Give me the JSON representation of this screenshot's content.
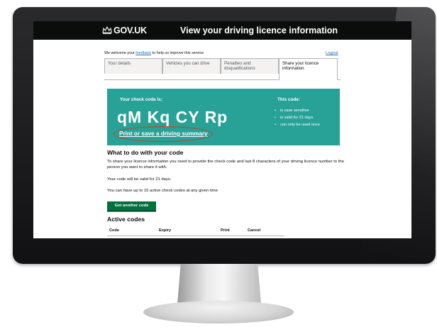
{
  "header": {
    "logo_text": "GOV.UK",
    "service_title": "View your driving licence information"
  },
  "feedback_bar": {
    "text_before": "We welcome your ",
    "link_text": "feedback",
    "text_after": " to help us improve this service",
    "logout_label": "Logout"
  },
  "tabs": [
    {
      "label": "Your details",
      "active": false
    },
    {
      "label": "Vehicles you can drive",
      "active": false
    },
    {
      "label": "Penalties and disqualifications",
      "active": false
    },
    {
      "label": "Share your licence information",
      "active": true
    }
  ],
  "code_panel": {
    "label": "Your check code is:",
    "code": "qM Kq CY Rp",
    "print_link": "Print or save a driving summary",
    "facts_title": "This code:",
    "facts": [
      "is case sensitive",
      "is valid for 21 days",
      "can only be used once"
    ],
    "panel_color": "#28a197",
    "highlight_color": "#d4351c"
  },
  "instructions": {
    "heading": "What to do with your code",
    "paragraph1": "To share your licence information you need to provide the check code and last 8 characters of your driving licence number to the person you want to share it with.",
    "paragraph2": "Your code will be valid for 21 days.",
    "paragraph3": "You can have up to 15 active check codes at any given time"
  },
  "get_code_button": {
    "label": "Get another code",
    "color": "#00703c"
  },
  "active_codes": {
    "heading": "Active codes",
    "columns": [
      "Code",
      "Expiry",
      "Print",
      "Cancel"
    ]
  }
}
